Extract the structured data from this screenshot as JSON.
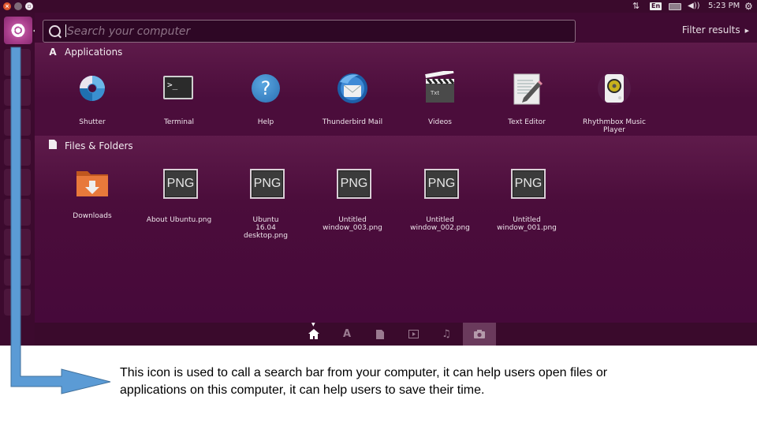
{
  "top_panel": {
    "window_buttons": [
      "close",
      "minimize",
      "maximize"
    ],
    "indicators": {
      "network_icon": "network-updown-icon",
      "keyboard_layout": "En",
      "battery_icon": "battery-icon",
      "volume_icon": "volume-icon",
      "time": "5:23 PM",
      "session_icon": "gear-power-icon"
    }
  },
  "launcher": {
    "dash_button": "ubuntu-logo-icon",
    "items": [
      "files",
      "firefox",
      "libreoffice-writer",
      "libreoffice-calc",
      "libreoffice-impress",
      "software-center",
      "amazon",
      "system-settings",
      "trash"
    ]
  },
  "dash": {
    "search": {
      "placeholder": "Search your computer",
      "value": ""
    },
    "filter_label": "Filter results",
    "sections": [
      {
        "title": "Applications",
        "icon": "applications-icon",
        "items": [
          {
            "label": "Shutter",
            "icon": "shutter-icon"
          },
          {
            "label": "Terminal",
            "icon": "terminal-icon"
          },
          {
            "label": "Help",
            "icon": "help-icon"
          },
          {
            "label": "Thunderbird Mail",
            "icon": "thunderbird-icon"
          },
          {
            "label": "Videos",
            "icon": "videos-icon"
          },
          {
            "label": "Text Editor",
            "icon": "text-editor-icon"
          },
          {
            "label": "Rhythmbox Music Player",
            "icon": "rhythmbox-icon"
          }
        ]
      },
      {
        "title": "Files & Folders",
        "icon": "file-icon",
        "items": [
          {
            "label": "Downloads",
            "icon": "folder-download-icon"
          },
          {
            "label": "About Ubuntu.png",
            "icon": "png-file-icon",
            "badge": "PNG"
          },
          {
            "label": "Ubuntu 16.04 desktop.png",
            "icon": "png-file-icon",
            "badge": "PNG"
          },
          {
            "label": "Untitled window_003.png",
            "icon": "png-file-icon",
            "badge": "PNG"
          },
          {
            "label": "Untitled window_002.png",
            "icon": "png-file-icon",
            "badge": "PNG"
          },
          {
            "label": "Untitled window_001.png",
            "icon": "png-file-icon",
            "badge": "PNG"
          }
        ]
      }
    ],
    "lenses": [
      {
        "name": "home",
        "active": true
      },
      {
        "name": "applications",
        "active": false
      },
      {
        "name": "files",
        "active": false
      },
      {
        "name": "videos",
        "active": false
      },
      {
        "name": "music",
        "active": false
      },
      {
        "name": "photos",
        "active": false,
        "highlighted": true
      }
    ]
  },
  "annotation": {
    "arrow_color": "#5b9bd5",
    "text": "This icon is used to call a search bar from your computer, it can help users open files or applications on this computer, it can help users to save their time."
  }
}
